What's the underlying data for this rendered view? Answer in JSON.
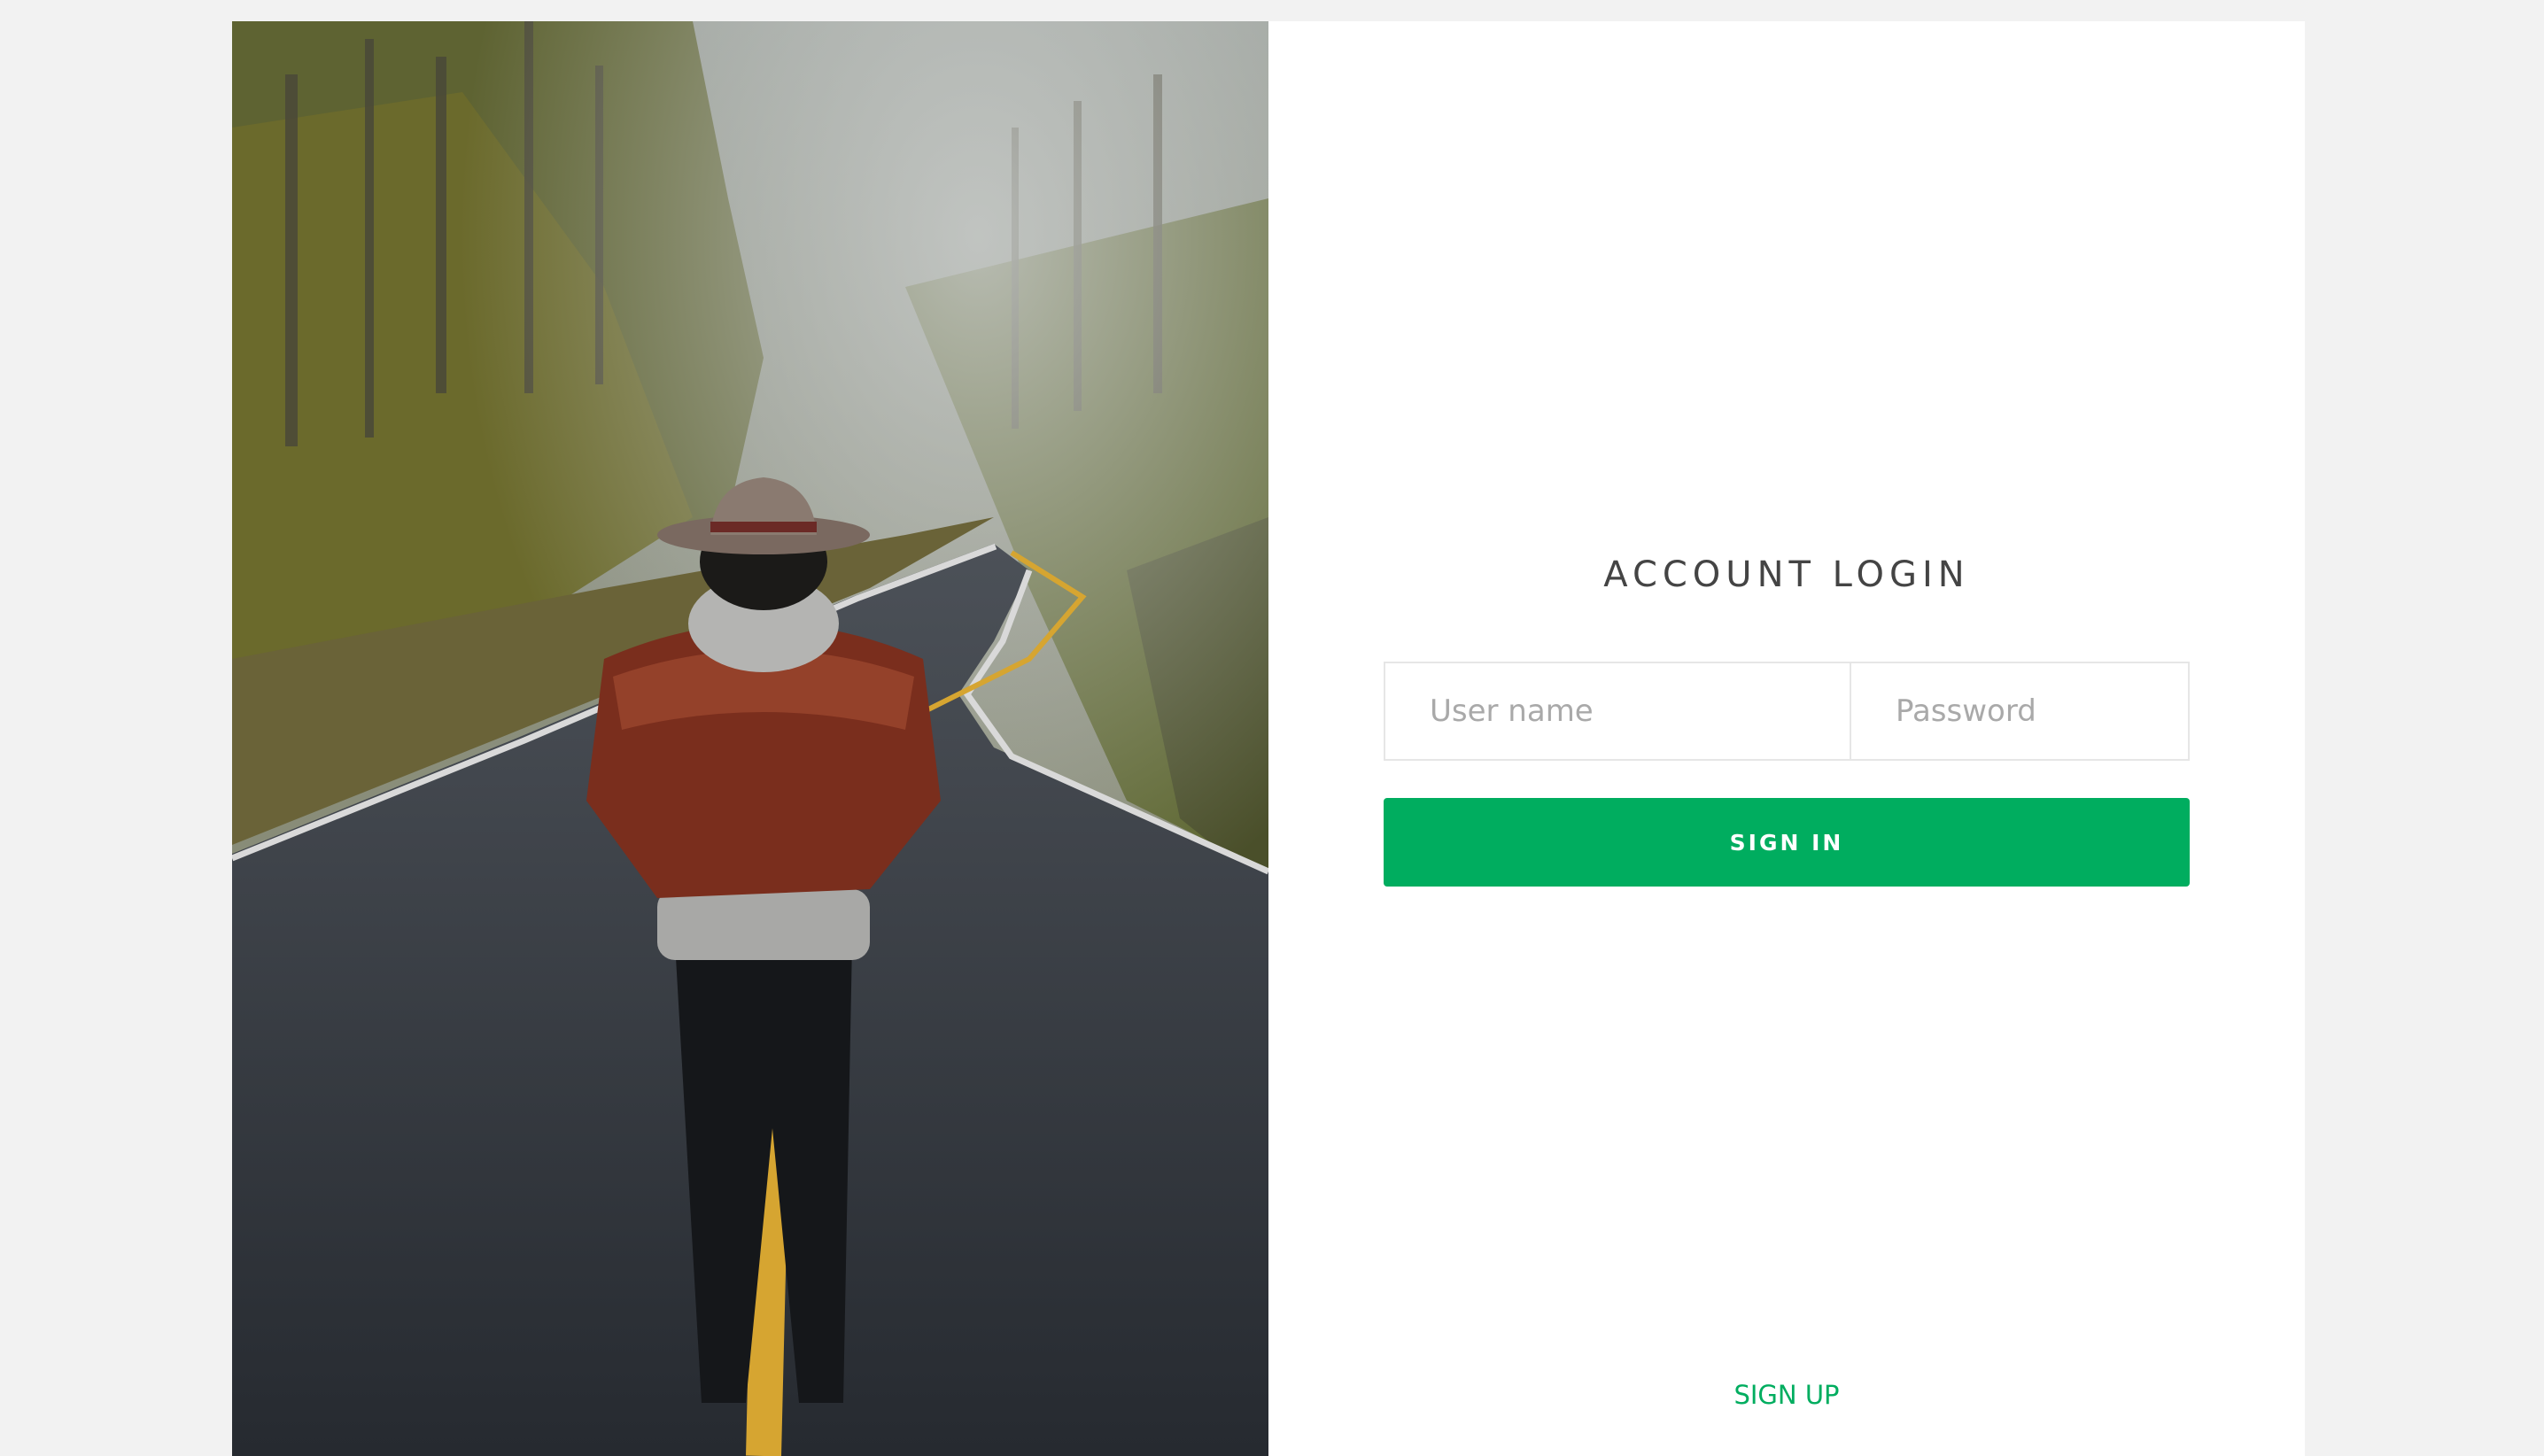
{
  "login": {
    "title": "ACCOUNT LOGIN",
    "username_placeholder": "User name",
    "username_value": "",
    "password_placeholder": "Password",
    "password_value": "",
    "signin_label": "SIGN IN",
    "signup_label": "SIGN UP"
  },
  "colors": {
    "accent": "#00ad5f",
    "page_background": "#f2f2f2",
    "card_background": "#ffffff",
    "title_text": "#444444",
    "placeholder_text": "#a9a9a9"
  },
  "photo": {
    "icon": "forest-road-photo"
  }
}
